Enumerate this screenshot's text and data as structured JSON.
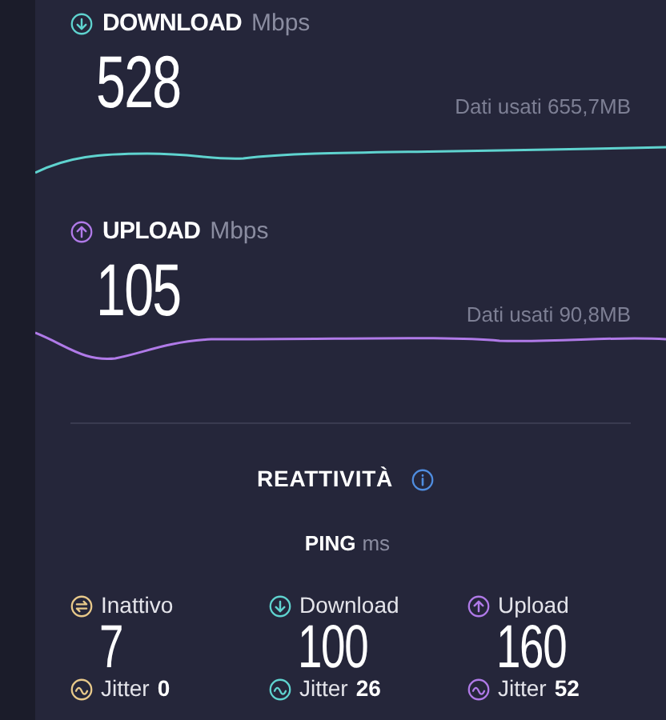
{
  "speeds": [
    {
      "kind": "download",
      "label": "DOWNLOAD",
      "unit": "Mbps",
      "value": "528",
      "data_used": "Dati usati 655,7MB",
      "color": "#5fd3cf"
    },
    {
      "kind": "upload",
      "label": "UPLOAD",
      "unit": "Mbps",
      "value": "105",
      "data_used": "Dati usati 90,8MB",
      "color": "#b07ae8"
    }
  ],
  "responsiveness": {
    "title": "REATTIVITÀ",
    "ping_label": "PING",
    "ping_unit": "ms",
    "columns": [
      {
        "kind": "idle",
        "label": "Inattivo",
        "value": "7",
        "jitter_label": "Jitter",
        "jitter": "0",
        "color": "#e8c98a"
      },
      {
        "kind": "download",
        "label": "Download",
        "value": "100",
        "jitter_label": "Jitter",
        "jitter": "26",
        "color": "#5fd3cf"
      },
      {
        "kind": "upload",
        "label": "Upload",
        "value": "160",
        "jitter_label": "Jitter",
        "jitter": "52",
        "color": "#b07ae8"
      }
    ]
  }
}
